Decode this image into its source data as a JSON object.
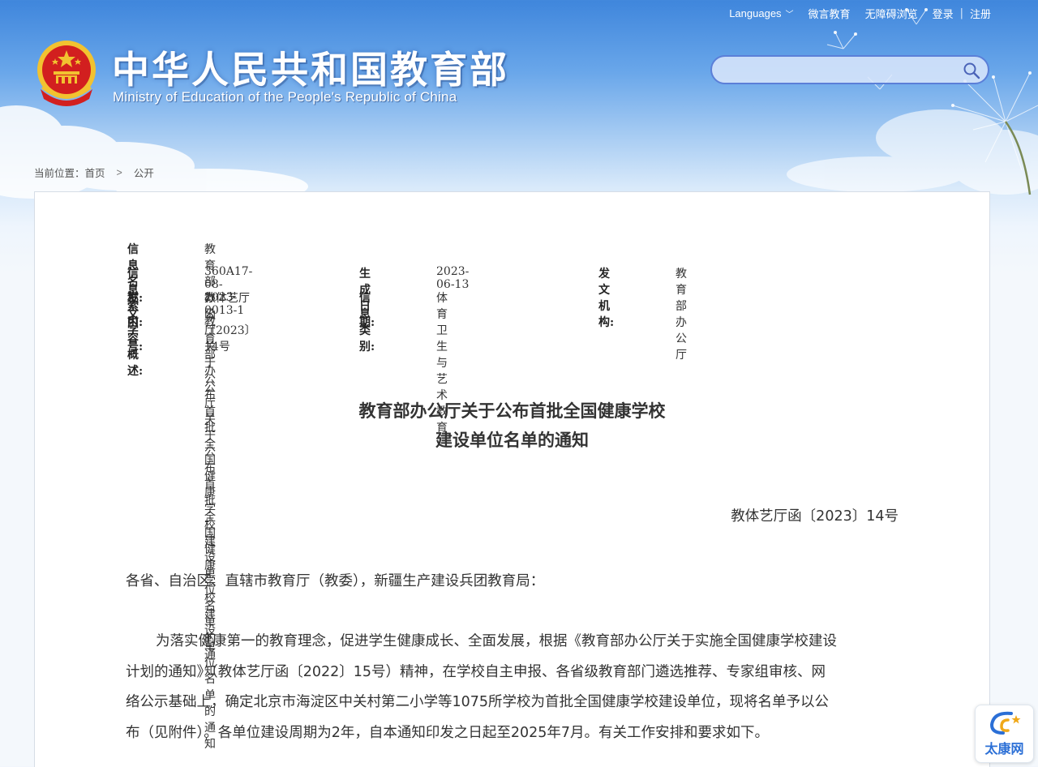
{
  "topbar": {
    "languages": "Languages",
    "weibo": "微言教育",
    "accessible": "无障碍浏览",
    "login": "登录",
    "register": "注册"
  },
  "header": {
    "title_cn": "中华人民共和国教育部",
    "title_en": "Ministry of Education of the People's Republic of China"
  },
  "search": {
    "placeholder": ""
  },
  "breadcrumb": {
    "label": "当前位置：",
    "home": "首页",
    "current": "公开"
  },
  "meta": {
    "name_label": "信息名称:",
    "name_value": "教育部办公厅关于公布首批全国健康学校建设单位名单的通知",
    "index_label": "信息索引:",
    "index_value": "360A17-08-2023-0013-1",
    "date_label": "生成日期:",
    "date_value": "2023-06-13",
    "org_label": "发文机构:",
    "org_value": "教育部办公厅",
    "docno_label": "发文字号:",
    "docno_value": "教体艺厅函〔2023〕14号",
    "category_label": "信息类别:",
    "category_value": "体育卫生与艺术教育",
    "summary_label": "内容概述:",
    "summary_value": "教育部办公厅关于公布首批全国健康学校建设单位名单的通知"
  },
  "document": {
    "title_line1": "教育部办公厅关于公布首批全国健康学校",
    "title_line2": "建设单位名单的通知",
    "doc_number": "教体艺厅函〔2023〕14号",
    "addressee": "各省、自治区、直辖市教育厅（教委），新疆生产建设兵团教育局：",
    "body_lines": [
      "为落实健康第一的教育理念，促进学生健康成长、全面发展，根据《教育部办公厅关于实施全国健康学校建设",
      "计划的通知》（教体艺厅函〔2022〕15号）精神，在学校自主申报、各省级教育部门遴选推荐、专家组审核、网",
      "络公示基础上，确定北京市海淀区中关村第二小学等1075所学校为首批全国健康学校建设单位，现将名单予以公",
      "布（见附件）。各单位建设周期为2年，自本通知印发之日起至2025年7月。有关工作安排和要求如下。"
    ]
  },
  "watermark": {
    "text": "太康网"
  },
  "colors": {
    "sky_top": "#3f86dc",
    "emblem_red": "#d21f1f",
    "emblem_gold": "#f2c230",
    "search_border": "#5b7fd8",
    "watermark_blue": "#2b6fd6"
  }
}
